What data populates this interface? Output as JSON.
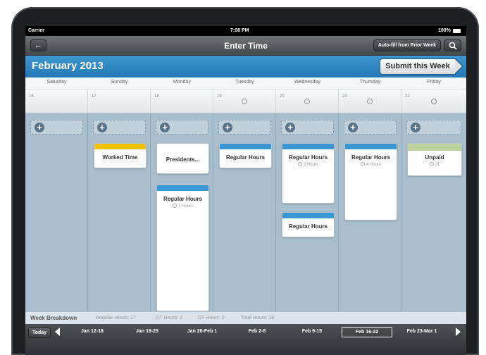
{
  "status": {
    "carrier": "Carrier",
    "time": "7:08 PM",
    "battery": "100%"
  },
  "nav": {
    "title": "Enter Time",
    "autofill_label": "Auto-fill from Prior Week"
  },
  "header": {
    "month": "February 2013",
    "submit_label": "Submit this Week"
  },
  "days": [
    {
      "name": "Saturday",
      "date": "16"
    },
    {
      "name": "Sunday",
      "date": "17"
    },
    {
      "name": "Monday",
      "date": "18"
    },
    {
      "name": "Tuesday",
      "date": "19"
    },
    {
      "name": "Wednesday",
      "date": "20"
    },
    {
      "name": "Thursday",
      "date": "21"
    },
    {
      "name": "Friday",
      "date": "22"
    }
  ],
  "entries": {
    "sunday_worked": {
      "title": "Worked Time",
      "color": "#f2c200"
    },
    "monday_presidents": {
      "title": "Presidents...",
      "color": "#ffffff"
    },
    "monday_regular": {
      "title": "Regular Hours",
      "hours": "7 Hours",
      "color": "#3b97d3"
    },
    "tuesday_regular": {
      "title": "Regular Hours",
      "color": "#3b97d3"
    },
    "wednesday_regular": {
      "title": "Regular Hours",
      "hours": "3 Hours",
      "color": "#3b97d3"
    },
    "wednesday_regular2": {
      "title": "Regular Hours",
      "color": "#3b97d3"
    },
    "thursday_regular": {
      "title": "Regular Hours",
      "hours": "4 Hours",
      "color": "#3b97d3"
    },
    "friday_unpaid": {
      "title": "Unpaid",
      "hours": "21",
      "color": "#b9d39a"
    }
  },
  "breakdown": {
    "title": "Week Breakdown",
    "regular": "Regular Hours: 17",
    "ot": "OT Hours: 2",
    "dt": "DT Hours: 0",
    "total": "Total Hours: 19"
  },
  "footer": {
    "today_label": "Today",
    "weeks": [
      "Jan 12-18",
      "Jan 19-25",
      "Jan 26-Feb 1",
      "Feb 2-8",
      "Feb 9-15",
      "Feb 16-22",
      "Feb 23-Mar 1"
    ],
    "selected_week": "Feb 16-22"
  }
}
